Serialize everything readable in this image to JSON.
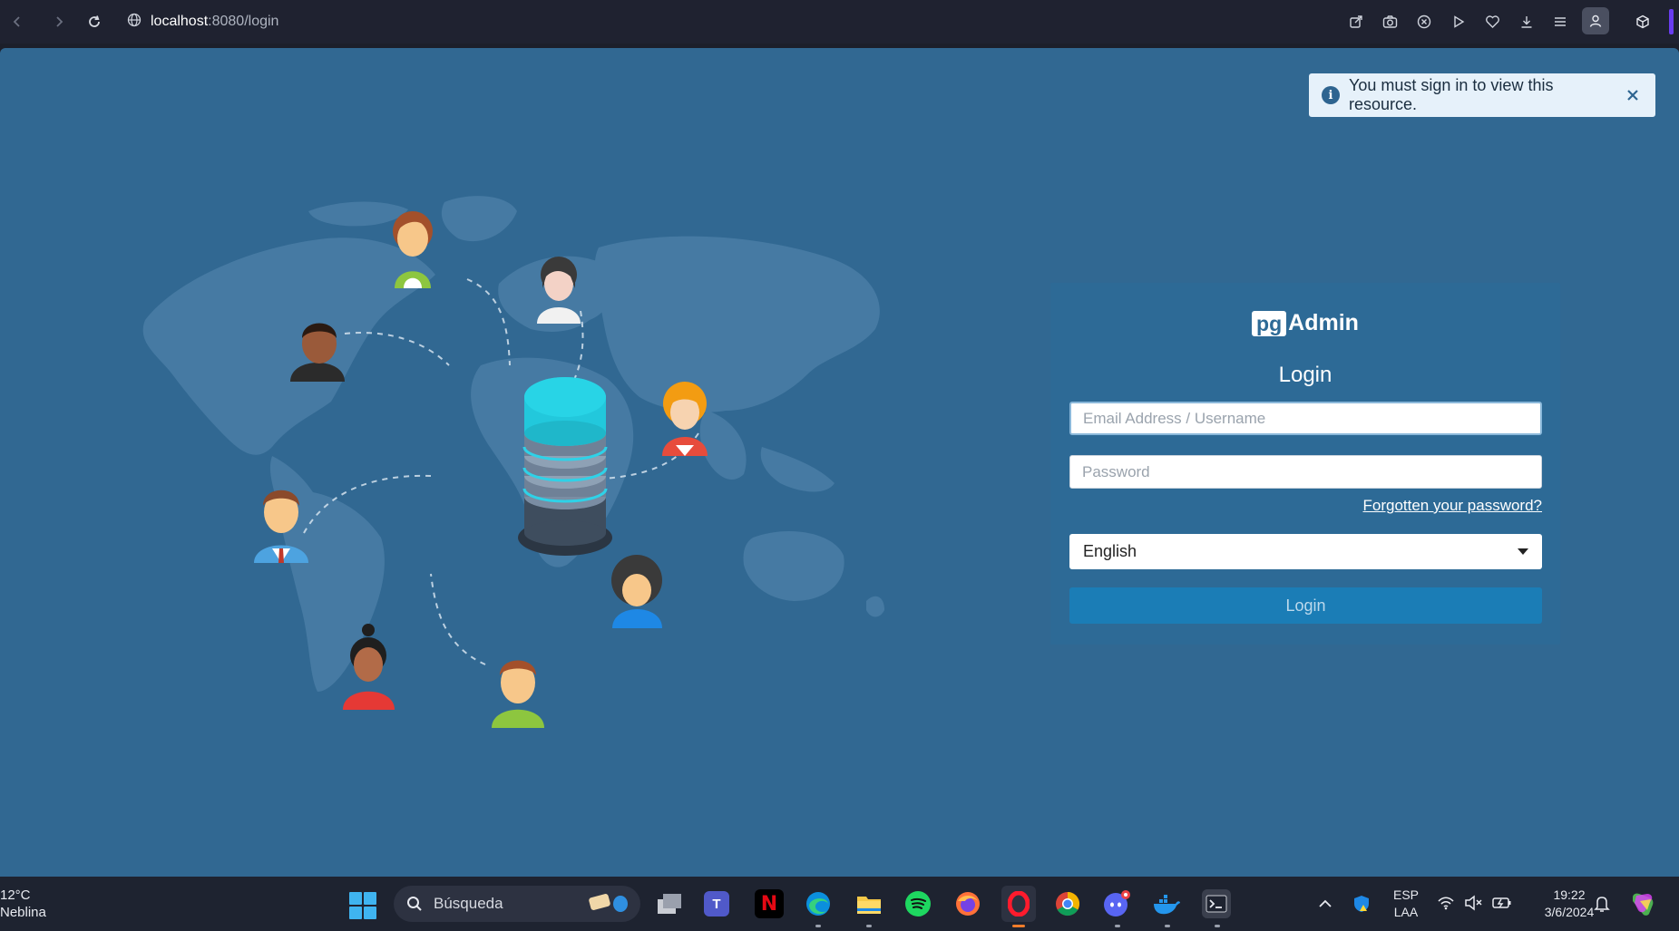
{
  "browser": {
    "url_host": "localhost",
    "url_rest": ":8080/login"
  },
  "toast": {
    "message": "You must sign in to view this resource."
  },
  "login": {
    "brand_pg": "pg",
    "brand_admin": "Admin",
    "title": "Login",
    "email_placeholder": "Email Address / Username",
    "password_placeholder": "Password",
    "forgot_link": "Forgotten your password?",
    "language_selected": "English",
    "submit_label": "Login"
  },
  "taskbar": {
    "weather_temp": "12°C",
    "weather_desc": "Neblina",
    "search_label": "Búsqueda",
    "lang_line1": "ESP",
    "lang_line2": "LAA",
    "time": "19:22",
    "date": "3/6/2024",
    "apps": [
      "file-explorer-icon",
      "teams-icon",
      "netflix-icon",
      "edge-icon",
      "folder-icon",
      "spotify-icon",
      "firefox-icon",
      "opera-icon",
      "chrome-icon",
      "discord-icon",
      "docker-icon",
      "terminal-icon"
    ]
  },
  "colors": {
    "page_bg": "#316892",
    "panel_bg": "#2d6a96",
    "button_bg": "#1b7db6",
    "toast_bg": "#e6f1fa"
  }
}
